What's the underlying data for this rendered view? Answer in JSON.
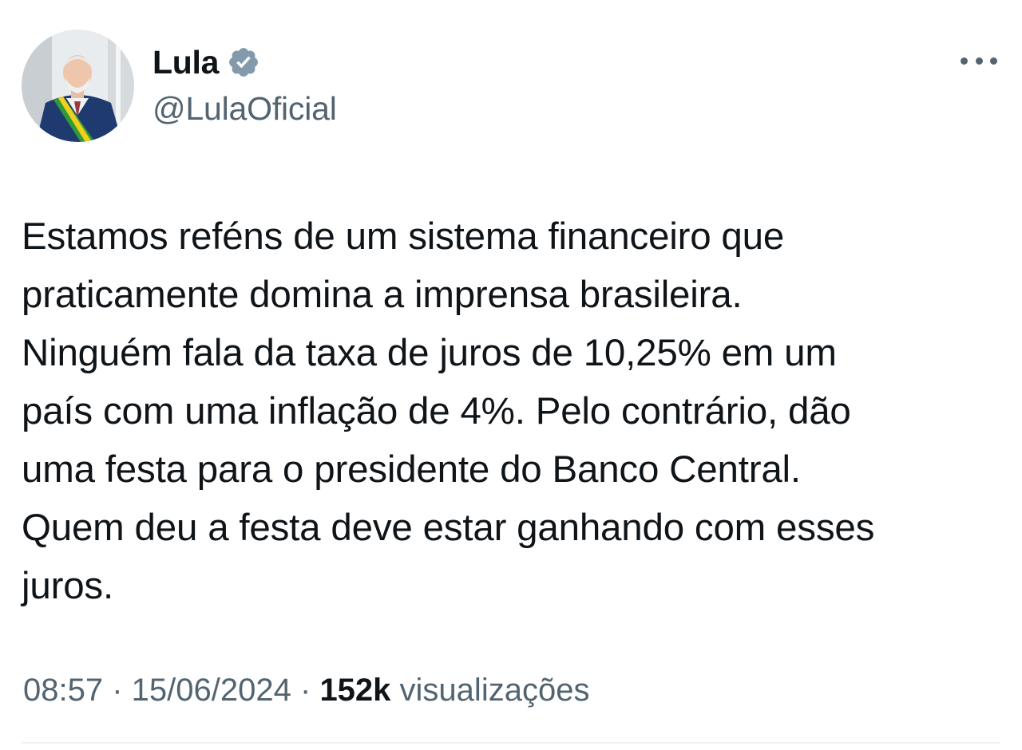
{
  "author": {
    "name": "Lula",
    "handle": "@LulaOficial",
    "verified_icon": "verified-badge-icon",
    "avatar_icon": "profile-photo",
    "verified_color": "#829aab"
  },
  "menu": {
    "icon": "more-options-icon"
  },
  "tweet": {
    "lines": [
      "Estamos reféns de um sistema financeiro que",
      "praticamente domina a imprensa brasileira.",
      "Ninguém fala da taxa de juros de 10,25% em um",
      "país com uma inflação de 4%. Pelo contrário, dão",
      "uma festa para o presidente do Banco Central.",
      "Quem deu a festa deve estar ganhando com esses",
      "juros."
    ]
  },
  "meta": {
    "time": "08:57",
    "separator": "·",
    "date": "15/06/2024",
    "views_count": "152k",
    "views_label": "visualizações"
  },
  "colors": {
    "text_primary": "#0f1419",
    "text_secondary": "#536471",
    "divider": "#eff3f4"
  }
}
